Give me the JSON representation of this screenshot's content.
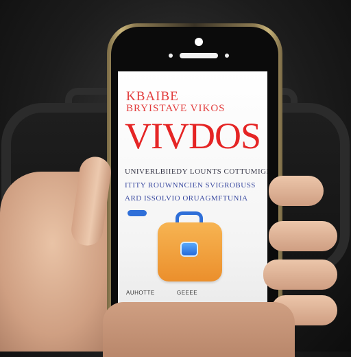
{
  "status_bar": {
    "left": "",
    "center": "",
    "right": ""
  },
  "article": {
    "kicker": "KBAIBE",
    "subkicker": "BRYISTAVE VIKOS",
    "headline": "VIVDOS",
    "line1": "UNIVERLBIIEDY LOUNTS COTTUMIGES",
    "line2": "ITITY ROUWNNCIEN SVIGROBUSS",
    "line3": "ARD ISSOLVIO ORUAGMFTUNIA"
  },
  "app": {
    "name": "suitcase-app"
  },
  "footer": {
    "left": "AUHOTTE",
    "right": "GEEEE"
  },
  "colors": {
    "headline": "#e52525",
    "accent": "#2f6fd8",
    "app_icon": "#f0a040"
  }
}
